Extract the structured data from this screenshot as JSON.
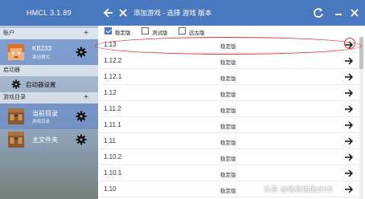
{
  "app": {
    "title": "HMCL 3.1.89"
  },
  "titlebar": {
    "breadcrumb": "添加游戏 - 选择 游戏 版本"
  },
  "sidebar": {
    "accounts_header": "账户",
    "accounts_add": "+",
    "account": {
      "name": "KB233",
      "subtitle": "离线模式"
    },
    "launcher_header": "启动器",
    "launcher_settings": "启动器设置",
    "game_dir_header": "游戏目录",
    "game_dir_add": "+",
    "dirs": [
      {
        "name": "当前目录",
        "subtitle": "游戏目录"
      },
      {
        "name": "主文件夹",
        "subtitle": ""
      }
    ]
  },
  "filters": [
    {
      "label": "稳定版",
      "checked": true
    },
    {
      "label": "测试版",
      "checked": false
    },
    {
      "label": "远古版",
      "checked": false
    }
  ],
  "versions": [
    {
      "name": "1.13",
      "type": "稳定版"
    },
    {
      "name": "1.12.2",
      "type": "稳定版"
    },
    {
      "name": "1.12.1",
      "type": "稳定版"
    },
    {
      "name": "1.12",
      "type": "稳定版"
    },
    {
      "name": "1.11.2",
      "type": "稳定版"
    },
    {
      "name": "1.11.1",
      "type": "稳定版"
    },
    {
      "name": "1.11",
      "type": "稳定版"
    },
    {
      "name": "1.10.2",
      "type": "稳定版"
    },
    {
      "name": "1.10.1",
      "type": "稳定版"
    },
    {
      "name": "1.10",
      "type": "稳定版"
    }
  ],
  "watermark": "头条 @佐佐佑佑2015",
  "colors": {
    "accent": "#4a78bf",
    "annotation": "#d83a3a"
  }
}
